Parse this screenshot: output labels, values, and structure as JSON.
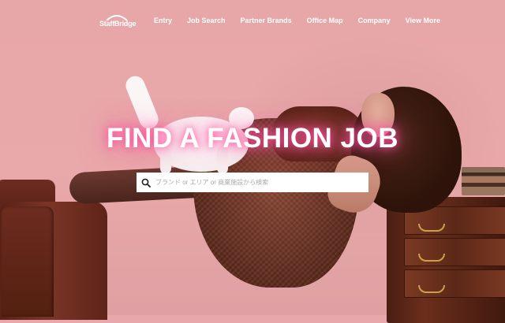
{
  "header": {
    "logo_text": "StaffBridge",
    "nav": [
      {
        "label": "Entry"
      },
      {
        "label": "Job Search"
      },
      {
        "label": "Partner Brands"
      },
      {
        "label": "Office Map"
      },
      {
        "label": "Company"
      },
      {
        "label": "View More"
      }
    ]
  },
  "hero": {
    "headline": "FIND A FASHION JOB",
    "search": {
      "placeholder": "ブランド or エリア or 商業施設から検索",
      "value": "",
      "icon": "search-icon"
    }
  },
  "colors": {
    "background": "#e8a7aa",
    "headline_glow": "#ff5aa8",
    "text": "#ffffff"
  }
}
